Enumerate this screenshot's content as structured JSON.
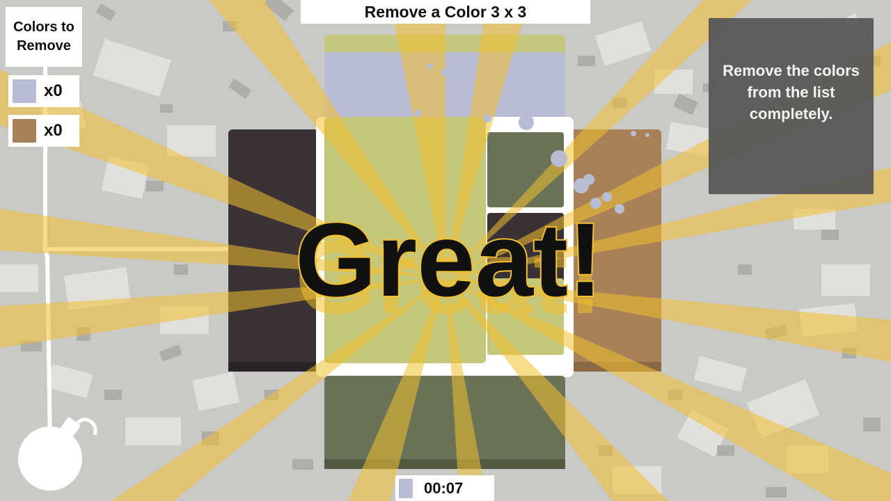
{
  "header": {
    "title": "Remove a Color 3 x 3"
  },
  "colors_panel": {
    "heading": "Colors to Remove",
    "items": [
      {
        "color_name": "lavender-gray",
        "color": "#b9bdd3",
        "count": "x0"
      },
      {
        "color_name": "tan-brown",
        "color": "#a88158",
        "count": "x0"
      }
    ]
  },
  "hint": {
    "text": "Remove the colors from the list completely."
  },
  "timer": {
    "swatch_color": "#b9bdd3",
    "time": "00:07"
  },
  "banner": {
    "text": "Great!"
  },
  "palette": {
    "background": "#c9c9c5",
    "ray": "#f2c030",
    "dark_tile": "#3a3235",
    "olive_tile": "#6a7357",
    "yellow_green_tile": "#c4c67a",
    "lavender_tile": "#b9bdd3",
    "brown_tile": "#a88158",
    "highlight_border": "#ffffff"
  }
}
